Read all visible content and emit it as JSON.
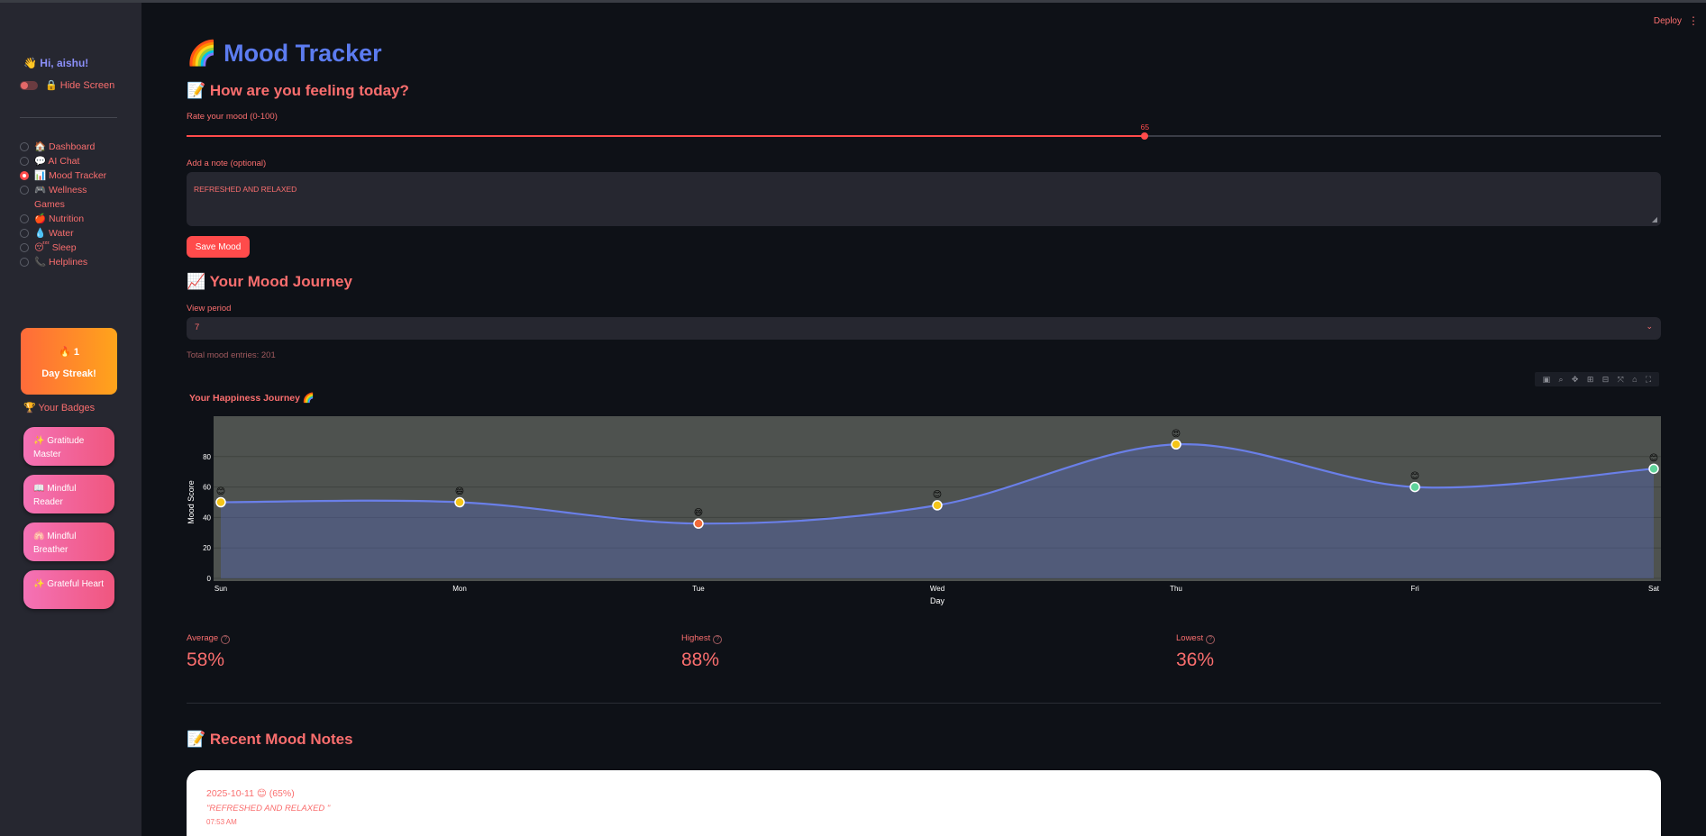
{
  "sidebar": {
    "greeting": "👋 Hi, aishu!",
    "hide_screen_label": "🔒 Hide Screen",
    "nav": [
      {
        "label": "🏠 Dashboard",
        "selected": false
      },
      {
        "label": "💬 AI Chat",
        "selected": false
      },
      {
        "label": "📊 Mood Tracker",
        "selected": true
      },
      {
        "label": "🎮 Wellness Games",
        "selected": false
      },
      {
        "label": "🍎 Nutrition",
        "selected": false
      },
      {
        "label": "💧 Water",
        "selected": false
      },
      {
        "label": "😴 Sleep",
        "selected": false
      },
      {
        "label": "📞 Helplines",
        "selected": false
      }
    ],
    "streak_number": "🔥 1",
    "streak_label": "Day Streak!",
    "badges_title": "🏆 Your Badges",
    "badges": [
      "✨ Gratitude Master",
      "📖 Mindful Reader",
      "🫁 Mindful Breather",
      "✨ Grateful Heart"
    ]
  },
  "header": {
    "deploy": "Deploy",
    "menu": "⋮"
  },
  "main": {
    "title": "🌈 Mood Tracker",
    "feeling_heading": "📝 How are you feeling today?",
    "slider_label": "Rate your mood (0-100)",
    "slider_value": 65,
    "slider_value_text": "65",
    "note_label": "Add a note (optional)",
    "note_value": "REFRESHED AND RELAXED",
    "save_button": "Save Mood",
    "journey_heading": "📈 Your Mood Journey",
    "period_label": "View period",
    "period_value": "7",
    "total_entries": "Total mood entries: 201",
    "metrics": [
      {
        "label": "Average",
        "value": "58%"
      },
      {
        "label": "Highest",
        "value": "88%"
      },
      {
        "label": "Lowest",
        "value": "36%"
      }
    ],
    "recent_heading": "📝 Recent Mood Notes",
    "recent_note": {
      "date": "2025-10-11 😊 (65%)",
      "text": "\"REFRESHED AND RELAXED \"",
      "time": "07:53 AM"
    }
  },
  "toolbar_icons": [
    "camera-icon",
    "zoom-icon",
    "pan-icon",
    "zoom-in-icon",
    "zoom-out-icon",
    "autoscale-icon",
    "home-icon",
    "fullscreen-icon"
  ],
  "colors": {
    "accent": "#ff4b4b",
    "title": "#5c7cf0",
    "text": "#fa6e6e",
    "line": "#6a7fe8",
    "plot_bg": "#4e524f"
  },
  "chart_data": {
    "type": "line",
    "title": "Your Happiness Journey 🌈",
    "xlabel": "Day",
    "ylabel": "Mood Score",
    "categories": [
      "Sun",
      "Mon",
      "Tue",
      "Wed",
      "Thu",
      "Fri",
      "Sat"
    ],
    "values": [
      50,
      50,
      36,
      48,
      88,
      60,
      72
    ],
    "emojis": [
      "😊",
      "😄",
      "😄",
      "😊",
      "😍",
      "😊",
      "😊"
    ],
    "point_colors": [
      "#f5c518",
      "#f5c518",
      "#f06a3a",
      "#f5c518",
      "#f5c518",
      "#5fd39a",
      "#5fd39a"
    ],
    "ylim": [
      0,
      100
    ],
    "yticks": [
      0,
      20,
      40,
      60,
      80
    ],
    "grid": true,
    "fill": "area"
  }
}
